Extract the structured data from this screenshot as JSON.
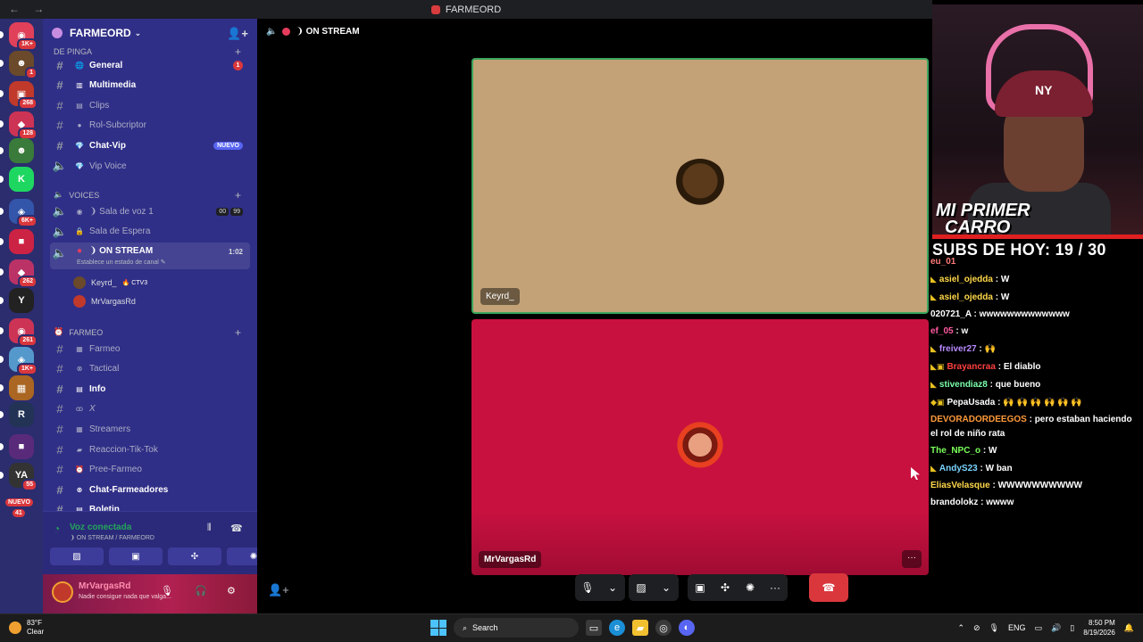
{
  "window": {
    "title": "FARMEORD",
    "nav": "← →"
  },
  "rail": {
    "servers": [
      {
        "badge": "1K+",
        "color": "#e0405a",
        "glyph": "◉"
      },
      {
        "badge": "1",
        "color": "#6a4a2a",
        "glyph": "☻"
      },
      {
        "badge": "268",
        "color": "#c0392b",
        "glyph": "▣"
      },
      {
        "badge": "128",
        "color": "#cc3355",
        "glyph": "◆"
      },
      {
        "badge": "",
        "color": "#3a7a3a",
        "glyph": "☻"
      },
      {
        "badge": "",
        "color": "#1ed760",
        "glyph": "K"
      },
      {
        "badge": "6K+",
        "color": "#3355aa",
        "glyph": "◈"
      },
      {
        "badge": "",
        "color": "#cc2244",
        "glyph": "■"
      },
      {
        "badge": "262",
        "color": "#bb3366",
        "glyph": "◆"
      },
      {
        "badge": "",
        "color": "#222",
        "glyph": "Y"
      },
      {
        "badge": "261",
        "color": "#cc3355",
        "glyph": "◉"
      },
      {
        "badge": "1K+",
        "color": "#5599cc",
        "glyph": "◈"
      },
      {
        "badge": "",
        "color": "#aa6622",
        "glyph": "▦"
      },
      {
        "badge": "",
        "color": "#223355",
        "glyph": "R"
      },
      {
        "badge": "",
        "color": "#5a2a7a",
        "glyph": "■"
      },
      {
        "badge": "55",
        "color": "#333",
        "glyph": "YA"
      }
    ],
    "nuevo_label": "NUEVO",
    "nuevo_count": "41"
  },
  "sidebar": {
    "guild_name": "FARMEORD",
    "categories": {
      "top": "DE PINGA",
      "voices": "VOICES",
      "farmeo": "FARMEO"
    },
    "channels_text_top": [
      {
        "name": "General",
        "emoji": "🌐",
        "bold": true,
        "badge": "1"
      },
      {
        "name": "Multimedia",
        "emoji": "▥",
        "bold": true,
        "badge": ""
      },
      {
        "name": "Clips",
        "emoji": "▤",
        "bold": false,
        "badge": ""
      },
      {
        "name": "Rol-Subcriptor",
        "emoji": "●",
        "bold": false,
        "badge": ""
      },
      {
        "name": "Chat-Vip",
        "emoji": "💎",
        "bold": true,
        "badge": "NUEVO"
      },
      {
        "name": "Vip Voice",
        "emoji": "💎",
        "bold": false,
        "badge": ""
      }
    ],
    "voice_channels": [
      {
        "name": "❩ Sala de voz 1",
        "count_a": "00",
        "count_b": "99"
      },
      {
        "name": "Sala de Espera",
        "count_a": "",
        "count_b": ""
      }
    ],
    "active_channel": {
      "name": "❩ ON STREAM",
      "timer": "1:02",
      "status": "Establece un estado de canal ✎"
    },
    "voice_users": [
      {
        "name": "Keyrd_",
        "tag": "🔥 CTV3"
      },
      {
        "name": "MrVargasRd",
        "tag": ""
      }
    ],
    "channels_farmeo": [
      {
        "name": "Farmeo",
        "emoji": "▦",
        "bold": false
      },
      {
        "name": "Tactical",
        "emoji": "⊗",
        "bold": false
      },
      {
        "name": "Info",
        "emoji": "▤",
        "bold": true
      },
      {
        "name": "X",
        "emoji": "ꝏ",
        "bold": false
      },
      {
        "name": "Streamers",
        "emoji": "▦",
        "bold": false
      },
      {
        "name": "Reaccion-Tik-Tok",
        "emoji": "▰",
        "bold": false
      },
      {
        "name": "Pree-Farmeo",
        "emoji": "⏰",
        "bold": false
      },
      {
        "name": "Chat-Farmeadores",
        "emoji": "⊗",
        "bold": true
      },
      {
        "name": "Boletin",
        "emoji": "▤",
        "bold": true
      }
    ],
    "voice_panel": {
      "status": "Voz conectada",
      "location": "❩ ON STREAM / FARMEORD"
    },
    "user": {
      "name": "MrVargasRd",
      "status": "Nadie consigue nada que valga..."
    }
  },
  "stage": {
    "channel": "❩ ON STREAM",
    "tiles": [
      {
        "name": "Keyrd_"
      },
      {
        "name": "MrVargasRd",
        "more": "···"
      }
    ]
  },
  "overlay": {
    "cap_logo": "NY",
    "banner_line1": "MI PRIMER",
    "banner_line2": "CARRO",
    "subs": "SUBS DE HOY: 19 / 30",
    "chat": [
      {
        "badge": "",
        "user": "eu_01",
        "color": "#ff7a7a",
        "text": ""
      },
      {
        "badge": "◣",
        "user": "asiel_ojedda",
        "color": "#ffd84a",
        "text": "W"
      },
      {
        "badge": "◣",
        "user": "asiel_ojedda",
        "color": "#ffd84a",
        "text": "W"
      },
      {
        "badge": "",
        "user": "020721_A",
        "color": "#ffffff",
        "text": "wwwwwwwwwwwww"
      },
      {
        "badge": "",
        "user": "ef_05",
        "color": "#ff5aa0",
        "text": "w"
      },
      {
        "badge": "◣",
        "user": "freiver27",
        "color": "#b98aff",
        "text": "🙌"
      },
      {
        "badge": "◣▣",
        "user": "Brayancraa",
        "color": "#ff4040",
        "text": "El diablo"
      },
      {
        "badge": "◣",
        "user": "stivendiaz8",
        "color": "#7affaa",
        "text": "que bueno"
      },
      {
        "badge": "◆▣",
        "user": "PepaUsada",
        "color": "#ffffff",
        "text": "🙌 🙌 🙌 🙌 🙌 🙌"
      },
      {
        "badge": "",
        "user": "DEVORADORDEEGOS",
        "color": "#ff9a3a",
        "text": "pero estaban haciendo el rol de niño rata"
      },
      {
        "badge": "",
        "user": "The_NPC_o",
        "color": "#7aff5a",
        "text": "W"
      },
      {
        "badge": "◣",
        "user": "AndyS23",
        "color": "#7ad4ff",
        "text": "W ban"
      },
      {
        "badge": "",
        "user": "EliasVelasque",
        "color": "#ffd84a",
        "text": "WWWWWWWWWW"
      },
      {
        "badge": "",
        "user": "brandolokz",
        "color": "#ffffff",
        "text": "wwww"
      }
    ]
  },
  "taskbar": {
    "temp": "83°F",
    "condition": "Clear",
    "search": "Search",
    "lang": "ENG",
    "time": "8:50 PM",
    "date": "8/19/2026"
  }
}
